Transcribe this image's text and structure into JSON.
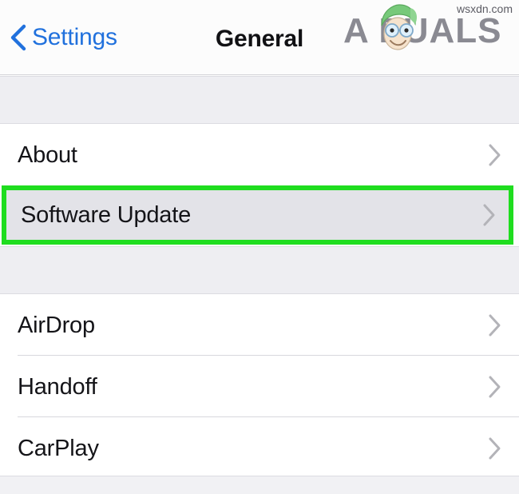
{
  "navbar": {
    "back_label": "Settings",
    "back_icon": "chevron-left-icon",
    "title": "General"
  },
  "watermark": {
    "brand_text": "A PUALS",
    "brand_prefix": "A",
    "brand_suffix": "PUALS",
    "face_icon": "mascot-face-icon",
    "footer_text": "wsxdn.com"
  },
  "colors": {
    "accent_blue": "#2171dd",
    "highlight_green": "#1fdd1f",
    "row_selected_bg": "#e3e3e8",
    "group_gap_bg": "#eeeef2",
    "chevron_gray": "#b3b3b8",
    "logo_gray": "#8a8a92",
    "logo_green": "#6ec06e"
  },
  "groups": [
    {
      "name": "group-a",
      "rows": [
        {
          "label": "About",
          "chevron": "chevron-right-icon",
          "selected": false
        }
      ]
    },
    {
      "name": "group-highlighted",
      "rows": [
        {
          "label": "Software Update",
          "chevron": "chevron-right-icon",
          "selected": true
        }
      ]
    },
    {
      "name": "group-b",
      "rows": [
        {
          "label": "AirDrop",
          "chevron": "chevron-right-icon",
          "selected": false
        },
        {
          "label": "Handoff",
          "chevron": "chevron-right-icon",
          "selected": false
        },
        {
          "label": "CarPlay",
          "chevron": "chevron-right-icon",
          "selected": false
        }
      ]
    }
  ]
}
